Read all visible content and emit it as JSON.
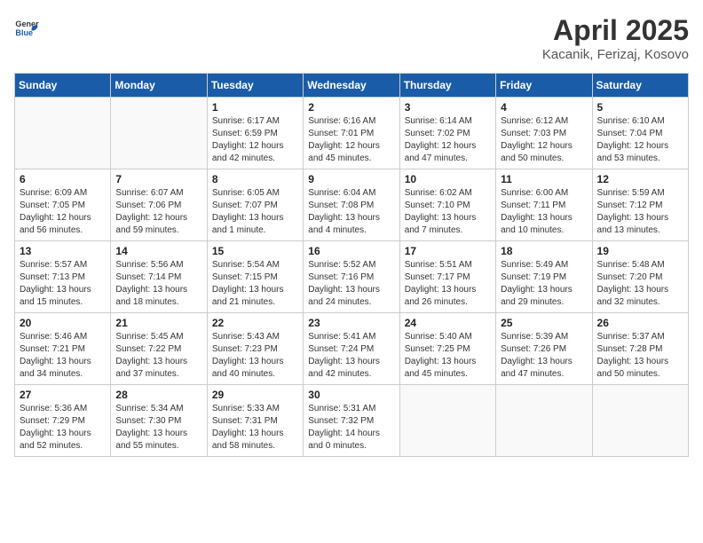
{
  "logo": {
    "general": "General",
    "blue": "Blue"
  },
  "title": {
    "month": "April 2025",
    "location": "Kacanik, Ferizaj, Kosovo"
  },
  "weekdays": [
    "Sunday",
    "Monday",
    "Tuesday",
    "Wednesday",
    "Thursday",
    "Friday",
    "Saturday"
  ],
  "weeks": [
    [
      {
        "day": "",
        "info": ""
      },
      {
        "day": "",
        "info": ""
      },
      {
        "day": "1",
        "info": "Sunrise: 6:17 AM\nSunset: 6:59 PM\nDaylight: 12 hours\nand 42 minutes."
      },
      {
        "day": "2",
        "info": "Sunrise: 6:16 AM\nSunset: 7:01 PM\nDaylight: 12 hours\nand 45 minutes."
      },
      {
        "day": "3",
        "info": "Sunrise: 6:14 AM\nSunset: 7:02 PM\nDaylight: 12 hours\nand 47 minutes."
      },
      {
        "day": "4",
        "info": "Sunrise: 6:12 AM\nSunset: 7:03 PM\nDaylight: 12 hours\nand 50 minutes."
      },
      {
        "day": "5",
        "info": "Sunrise: 6:10 AM\nSunset: 7:04 PM\nDaylight: 12 hours\nand 53 minutes."
      }
    ],
    [
      {
        "day": "6",
        "info": "Sunrise: 6:09 AM\nSunset: 7:05 PM\nDaylight: 12 hours\nand 56 minutes."
      },
      {
        "day": "7",
        "info": "Sunrise: 6:07 AM\nSunset: 7:06 PM\nDaylight: 12 hours\nand 59 minutes."
      },
      {
        "day": "8",
        "info": "Sunrise: 6:05 AM\nSunset: 7:07 PM\nDaylight: 13 hours\nand 1 minute."
      },
      {
        "day": "9",
        "info": "Sunrise: 6:04 AM\nSunset: 7:08 PM\nDaylight: 13 hours\nand 4 minutes."
      },
      {
        "day": "10",
        "info": "Sunrise: 6:02 AM\nSunset: 7:10 PM\nDaylight: 13 hours\nand 7 minutes."
      },
      {
        "day": "11",
        "info": "Sunrise: 6:00 AM\nSunset: 7:11 PM\nDaylight: 13 hours\nand 10 minutes."
      },
      {
        "day": "12",
        "info": "Sunrise: 5:59 AM\nSunset: 7:12 PM\nDaylight: 13 hours\nand 13 minutes."
      }
    ],
    [
      {
        "day": "13",
        "info": "Sunrise: 5:57 AM\nSunset: 7:13 PM\nDaylight: 13 hours\nand 15 minutes."
      },
      {
        "day": "14",
        "info": "Sunrise: 5:56 AM\nSunset: 7:14 PM\nDaylight: 13 hours\nand 18 minutes."
      },
      {
        "day": "15",
        "info": "Sunrise: 5:54 AM\nSunset: 7:15 PM\nDaylight: 13 hours\nand 21 minutes."
      },
      {
        "day": "16",
        "info": "Sunrise: 5:52 AM\nSunset: 7:16 PM\nDaylight: 13 hours\nand 24 minutes."
      },
      {
        "day": "17",
        "info": "Sunrise: 5:51 AM\nSunset: 7:17 PM\nDaylight: 13 hours\nand 26 minutes."
      },
      {
        "day": "18",
        "info": "Sunrise: 5:49 AM\nSunset: 7:19 PM\nDaylight: 13 hours\nand 29 minutes."
      },
      {
        "day": "19",
        "info": "Sunrise: 5:48 AM\nSunset: 7:20 PM\nDaylight: 13 hours\nand 32 minutes."
      }
    ],
    [
      {
        "day": "20",
        "info": "Sunrise: 5:46 AM\nSunset: 7:21 PM\nDaylight: 13 hours\nand 34 minutes."
      },
      {
        "day": "21",
        "info": "Sunrise: 5:45 AM\nSunset: 7:22 PM\nDaylight: 13 hours\nand 37 minutes."
      },
      {
        "day": "22",
        "info": "Sunrise: 5:43 AM\nSunset: 7:23 PM\nDaylight: 13 hours\nand 40 minutes."
      },
      {
        "day": "23",
        "info": "Sunrise: 5:41 AM\nSunset: 7:24 PM\nDaylight: 13 hours\nand 42 minutes."
      },
      {
        "day": "24",
        "info": "Sunrise: 5:40 AM\nSunset: 7:25 PM\nDaylight: 13 hours\nand 45 minutes."
      },
      {
        "day": "25",
        "info": "Sunrise: 5:39 AM\nSunset: 7:26 PM\nDaylight: 13 hours\nand 47 minutes."
      },
      {
        "day": "26",
        "info": "Sunrise: 5:37 AM\nSunset: 7:28 PM\nDaylight: 13 hours\nand 50 minutes."
      }
    ],
    [
      {
        "day": "27",
        "info": "Sunrise: 5:36 AM\nSunset: 7:29 PM\nDaylight: 13 hours\nand 52 minutes."
      },
      {
        "day": "28",
        "info": "Sunrise: 5:34 AM\nSunset: 7:30 PM\nDaylight: 13 hours\nand 55 minutes."
      },
      {
        "day": "29",
        "info": "Sunrise: 5:33 AM\nSunset: 7:31 PM\nDaylight: 13 hours\nand 58 minutes."
      },
      {
        "day": "30",
        "info": "Sunrise: 5:31 AM\nSunset: 7:32 PM\nDaylight: 14 hours\nand 0 minutes."
      },
      {
        "day": "",
        "info": ""
      },
      {
        "day": "",
        "info": ""
      },
      {
        "day": "",
        "info": ""
      }
    ]
  ]
}
